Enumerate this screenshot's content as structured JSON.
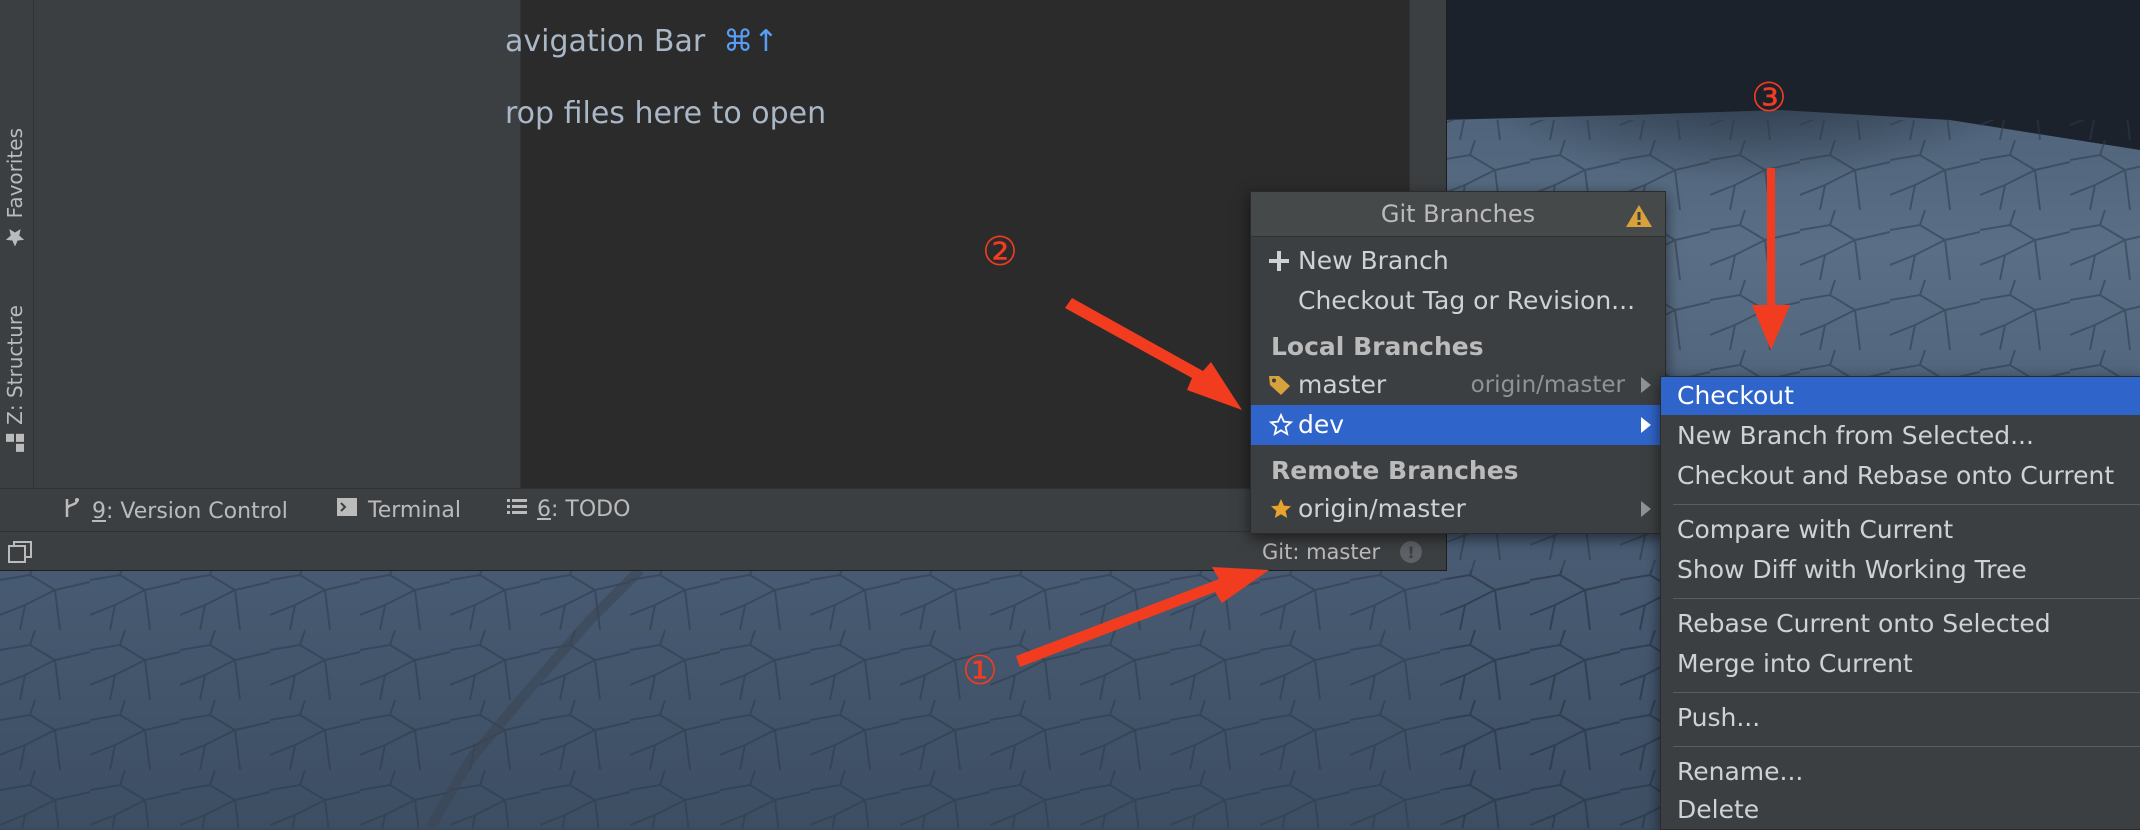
{
  "side_tabs": {
    "favorites": "Favorites",
    "structure": "Z: Structure"
  },
  "editor": {
    "hint_navbar": "avigation Bar",
    "hint_navbar_shortcut": "⌘↑",
    "hint_drop": "rop files here to open"
  },
  "tool_tabs": {
    "vc_num": "9",
    "vc_label": ": Version Control",
    "terminal": "Terminal",
    "todo_num": "6",
    "todo_label": ": TODO"
  },
  "status_bar": {
    "git": "Git: master",
    "event_glyph": "!"
  },
  "git_popup": {
    "title": "Git Branches",
    "new_branch": "New Branch",
    "checkout_tag": "Checkout Tag or Revision...",
    "local_header": "Local Branches",
    "local": [
      {
        "name": "master",
        "tracking": "origin/master",
        "icon": "tag-icon"
      },
      {
        "name": "dev",
        "tracking": "",
        "icon": "star-outline-icon"
      }
    ],
    "remote_header": "Remote Branches",
    "remote": [
      {
        "name": "origin/master",
        "icon": "star-filled-icon"
      }
    ]
  },
  "submenu": {
    "items": [
      "Checkout",
      "New Branch from Selected...",
      "Checkout and Rebase onto Current",
      "Compare with Current",
      "Show Diff with Working Tree",
      "Rebase Current onto Selected",
      "Merge into Current",
      "Push...",
      "Rename...",
      "Delete"
    ]
  },
  "annotations": {
    "n1": "①",
    "n2": "②",
    "n3": "③"
  },
  "colors": {
    "selection": "#2f65ca",
    "annotation": "#f13c1f",
    "panel": "#3c3f41",
    "editor": "#2b2b2b"
  }
}
